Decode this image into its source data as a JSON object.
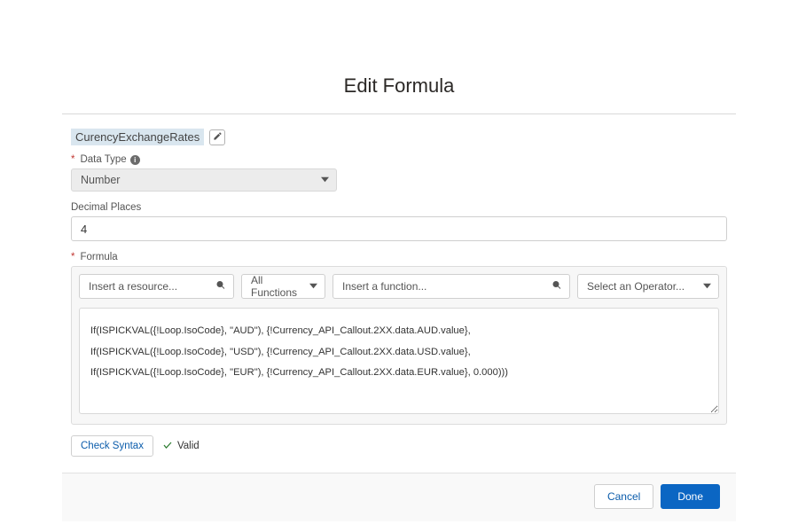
{
  "title": "Edit Formula",
  "apiName": "CurencyExchangeRates",
  "dataType": {
    "label": "Data Type",
    "value": "Number"
  },
  "decimalPlaces": {
    "label": "Decimal Places",
    "value": "4"
  },
  "formulaLabel": "Formula",
  "toolbar": {
    "resource_placeholder": "Insert a resource...",
    "functions_label": "All Functions",
    "function_placeholder": "Insert a function...",
    "operator_placeholder": "Select an Operator..."
  },
  "formula_text": "If(ISPICKVAL({!Loop.IsoCode}, \"AUD\"), {!Currency_API_Callout.2XX.data.AUD.value},\nIf(ISPICKVAL({!Loop.IsoCode}, \"USD\"), {!Currency_API_Callout.2XX.data.USD.value},\nIf(ISPICKVAL({!Loop.IsoCode}, \"EUR\"), {!Currency_API_Callout.2XX.data.EUR.value}, 0.000)))",
  "check_syntax": "Check Syntax",
  "valid_label": "Valid",
  "cancel_label": "Cancel",
  "done_label": "Done"
}
